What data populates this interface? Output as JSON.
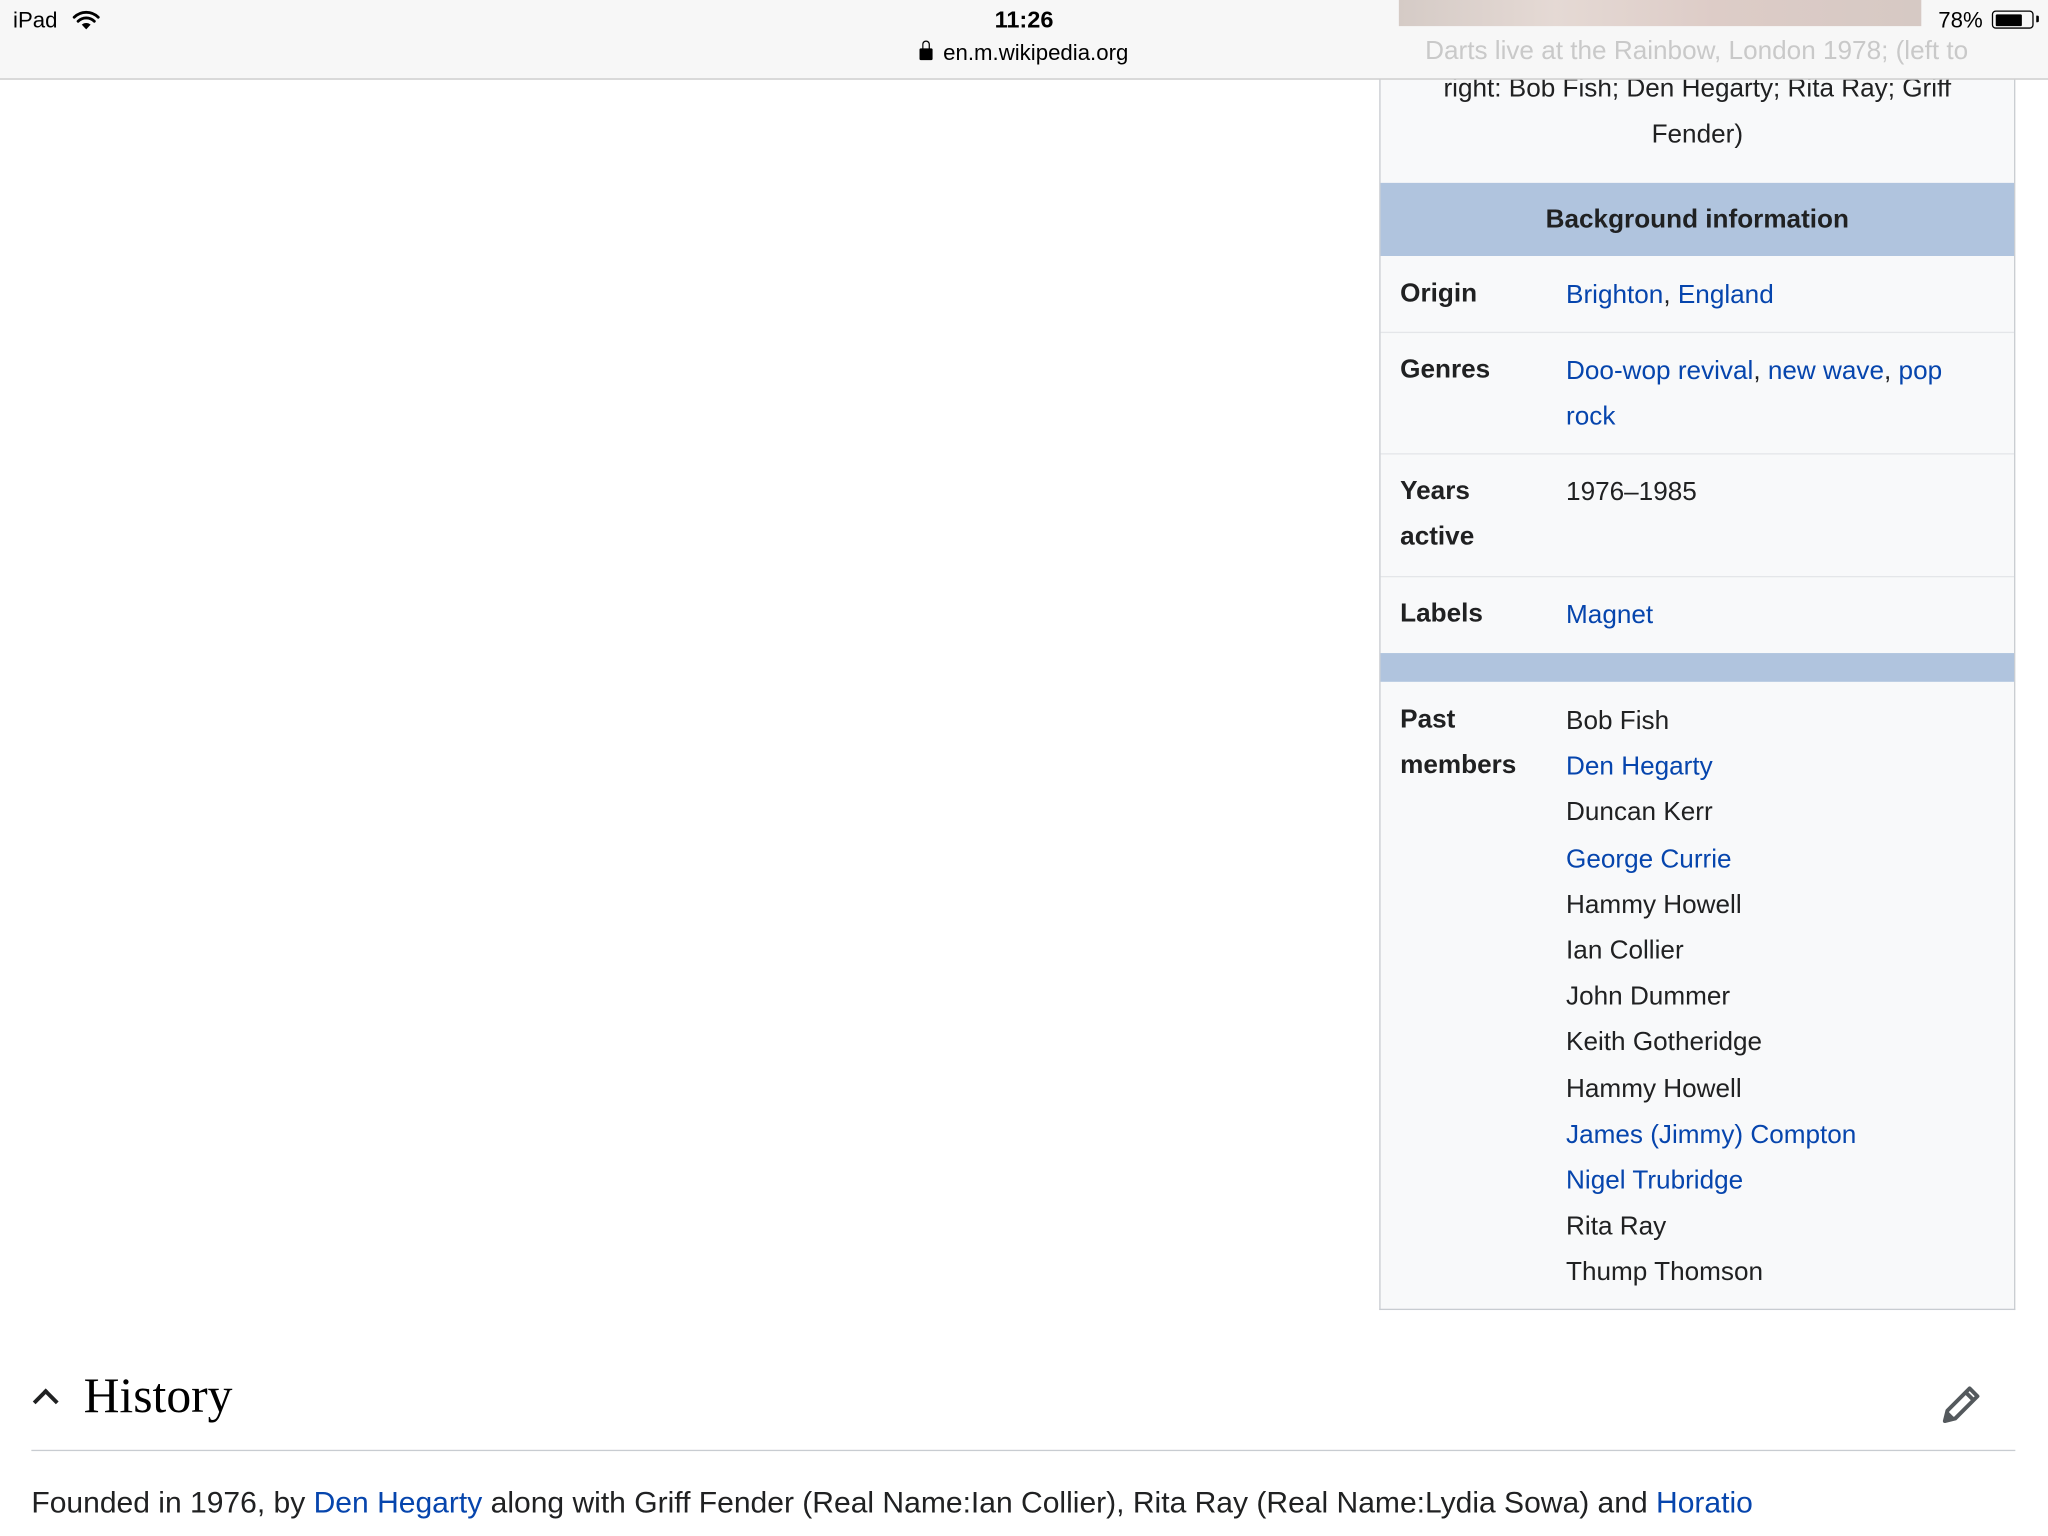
{
  "status_bar": {
    "device": "iPad",
    "time": "11:26",
    "battery_percent": "78%",
    "battery_level": 0.78
  },
  "address_bar": {
    "url": "en.m.wikipedia.org"
  },
  "infobox": {
    "caption_faded": "Darts live at the Rainbow, London 1978; (left to",
    "caption_line2": "right: Bob Fish; Den Hegarty; Rita Ray; Griff",
    "caption_line3": "Fender)",
    "header": "Background information",
    "origin": {
      "label": "Origin",
      "city": "Brighton",
      "sep": ", ",
      "country": "England"
    },
    "genres": {
      "label": "Genres",
      "items": [
        "Doo-wop revival",
        "new wave",
        "pop rock"
      ],
      "sep": ", "
    },
    "years_active": {
      "label_line1": "Years",
      "label_line2": "active",
      "value": "1976–1985"
    },
    "labels": {
      "label": "Labels",
      "value": "Magnet"
    },
    "past_members": {
      "label_line1": "Past",
      "label_line2": "members",
      "members": [
        {
          "name": "Bob Fish",
          "linked": false
        },
        {
          "name": "Den Hegarty",
          "linked": true
        },
        {
          "name": "Duncan Kerr",
          "linked": false
        },
        {
          "name": "George Currie",
          "linked": true
        },
        {
          "name": "Hammy Howell",
          "linked": false
        },
        {
          "name": "Ian Collier",
          "linked": false
        },
        {
          "name": "John Dummer",
          "linked": false
        },
        {
          "name": "Keith Gotheridge",
          "linked": false
        },
        {
          "name": "Hammy Howell",
          "linked": false
        },
        {
          "name": "James (Jimmy) Compton",
          "linked": true
        },
        {
          "name": "Nigel Trubridge",
          "linked": true
        },
        {
          "name": "Rita Ray",
          "linked": false
        },
        {
          "name": "Thump Thomson",
          "linked": false
        }
      ]
    }
  },
  "history": {
    "title": "History",
    "text_part1": "Founded in 1976, by ",
    "link1": "Den Hegarty",
    "text_part2": " along with Griff Fender (Real Name:Ian Collier), Rita Ray (Real Name:Lydia Sowa) and ",
    "link2": "Horatio"
  },
  "colors": {
    "link": "#0645ad",
    "infobox_header": "#b0c4de",
    "infobox_bg": "#f8f9fa"
  },
  "icons": {
    "wifi": "wifi-icon",
    "lock": "lock-icon",
    "battery": "battery-icon",
    "collapse": "chevron-up-icon",
    "edit": "pencil-icon"
  }
}
